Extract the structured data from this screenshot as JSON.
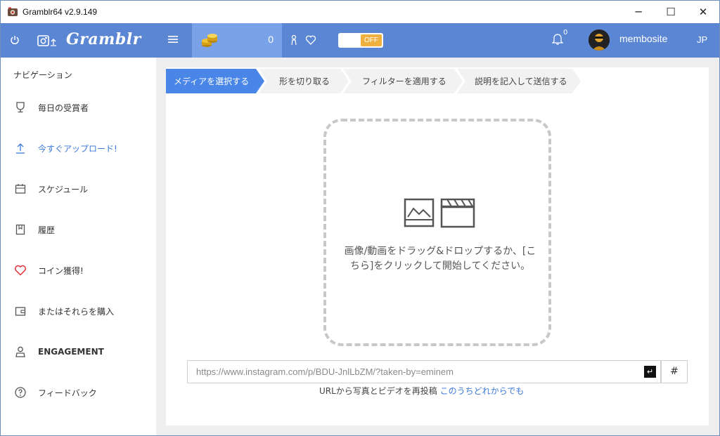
{
  "window": {
    "title": "Gramblr64 v2.9.149",
    "controls": {
      "minimize": "─",
      "maximize": "☐",
      "close": "✕"
    }
  },
  "header": {
    "logo": "Gramblr",
    "coin_count": "0",
    "toggle_label": "OFF",
    "notification_count": "0",
    "username": "membosite",
    "language": "JP",
    "brand_color": "#5b86d4"
  },
  "sidebar": {
    "title": "ナビゲーション",
    "items": [
      {
        "label": "毎日の受賞者",
        "icon": "trophy-icon"
      },
      {
        "label": "今すぐアップロード!",
        "icon": "upload-icon",
        "active": true
      },
      {
        "label": "スケジュール",
        "icon": "calendar-icon"
      },
      {
        "label": "履歴",
        "icon": "bookmark-icon"
      },
      {
        "label": "コイン獲得!",
        "icon": "heart-icon"
      },
      {
        "label": "またはそれらを購入",
        "icon": "wallet-icon"
      },
      {
        "label": "ENGAGEMENT",
        "icon": "person-icon"
      },
      {
        "label": "フィードバック",
        "icon": "question-icon"
      }
    ]
  },
  "steps": [
    {
      "label": "メディアを選択する",
      "active": true
    },
    {
      "label": "形を切り取る"
    },
    {
      "label": "フィルターを適用する"
    },
    {
      "label": "説明を記入して送信する"
    }
  ],
  "dropzone": {
    "text": "画像/動画をドラッグ&ドロップするか、[こちら]をクリックして開始してください。"
  },
  "url": {
    "value": "https://www.instagram.com/p/BDU-JnlLbZM/?taken-by=eminem",
    "hash_label": "#",
    "caption": "URLから写真とビデオを再投稿",
    "caption_link": "このうちどれからでも"
  }
}
